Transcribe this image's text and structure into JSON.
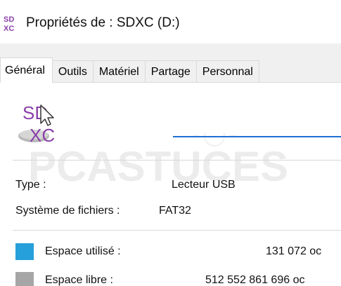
{
  "window": {
    "title": "Propriétés de : SDXC (D:)"
  },
  "icons": {
    "title_icon": "sdxc-drive-icon",
    "drive_icon": "sdxc-card-icon"
  },
  "tabs": [
    {
      "label": "Général",
      "active": true
    },
    {
      "label": "Outils",
      "active": false
    },
    {
      "label": "Matériel",
      "active": false
    },
    {
      "label": "Partage",
      "active": false
    },
    {
      "label": "Personnal",
      "active": false
    }
  ],
  "general": {
    "drive_name_value": "",
    "watermark_text": "PCASTUCES",
    "type_label": "Type :",
    "type_value": "Lecteur USB",
    "fs_label": "Système de fichiers :",
    "fs_value": "FAT32",
    "used_label": "Espace utilisé :",
    "used_value": "131 072 oc",
    "used_color": "#26a0da",
    "free_label": "Espace libre :",
    "free_value": "512 552 861 696 oc",
    "free_color": "#a6a6a6"
  },
  "colors": {
    "accent": "#1f6fd1",
    "sd_purple": "#8a3fa8"
  }
}
